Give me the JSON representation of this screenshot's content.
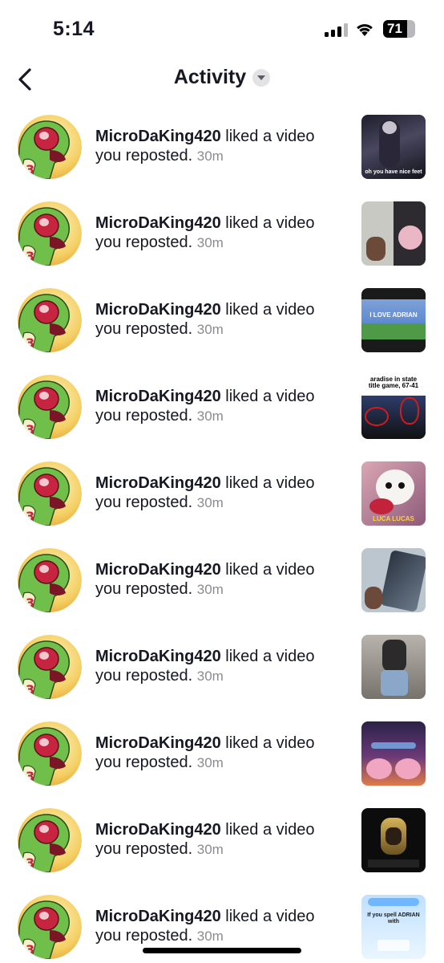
{
  "status_bar": {
    "time": "5:14",
    "battery": "71"
  },
  "header": {
    "title": "Activity"
  },
  "activity": {
    "items": [
      {
        "user": "MicroDaKing420",
        "action": " liked a video you reposted. ",
        "time": "30m",
        "thumb_caption": "oh you have nice feet"
      },
      {
        "user": "MicroDaKing420",
        "action": " liked a video you reposted. ",
        "time": "30m"
      },
      {
        "user": "MicroDaKing420",
        "action": " liked a video you reposted. ",
        "time": "30m",
        "thumb_caption": "I LOVE ADRIAN"
      },
      {
        "user": "MicroDaKing420",
        "action": " liked a video you reposted. ",
        "time": "30m",
        "thumb_caption": "aradise in state title game, 67-41"
      },
      {
        "user": "MicroDaKing420",
        "action": " liked a video you reposted. ",
        "time": "30m",
        "thumb_caption": "LUCA LUCAS"
      },
      {
        "user": "MicroDaKing420",
        "action": " liked a video you reposted. ",
        "time": "30m"
      },
      {
        "user": "MicroDaKing420",
        "action": " liked a video you reposted. ",
        "time": "30m"
      },
      {
        "user": "MicroDaKing420",
        "action": " liked a video you reposted. ",
        "time": "30m"
      },
      {
        "user": "MicroDaKing420",
        "action": " liked a video you reposted. ",
        "time": "30m"
      },
      {
        "user": "MicroDaKing420",
        "action": " liked a video you reposted. ",
        "time": "30m",
        "thumb_caption": "If you spell ADRIAN with"
      }
    ]
  }
}
